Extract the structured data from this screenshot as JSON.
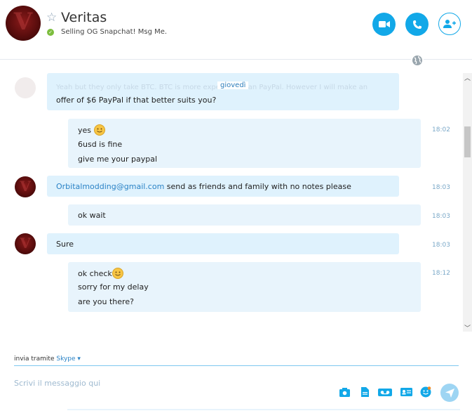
{
  "contact": {
    "name": "Veritas",
    "mood": "Selling OG Snapchat! Msg Me.",
    "avatar_letter": "V"
  },
  "header_actions": {
    "video_call": "video-camera-icon",
    "voice_call": "phone-icon",
    "add_contact": "add-person-icon"
  },
  "chat": {
    "day_label": "giovedì",
    "ghost_text": "Yeah but they only take BTC. BTC is more expensive than PayPal. However I will make an",
    "messages": [
      {
        "side": "left",
        "lines": [
          "offer of $6 PayPal if that better suits you?"
        ],
        "time": ""
      },
      {
        "side": "right",
        "lines": [
          "yes",
          "6usd is fine",
          "give me your paypal"
        ],
        "time": "18:02"
      },
      {
        "side": "left",
        "link": "Orbitalmodding@gmail.com",
        "text": " send as friends and family with no notes please",
        "time": "18:03"
      },
      {
        "side": "right",
        "lines": [
          "ok wait"
        ],
        "time": "18:03"
      },
      {
        "side": "left",
        "lines": [
          "Sure"
        ],
        "time": "18:03"
      },
      {
        "side": "right",
        "lines": [
          "ok check",
          "sorry for my delay",
          "are you there?"
        ],
        "time": "18:12"
      }
    ]
  },
  "compose": {
    "send_via_label": "invia tramite",
    "send_via_service": "Skype",
    "placeholder": "Scrivi il messaggio qui"
  },
  "colors": {
    "accent": "#12a8e8",
    "bubble_left": "#dff2fd",
    "bubble_right": "#e8f4fc",
    "link": "#2b83c6",
    "online": "#7cbd3d"
  }
}
